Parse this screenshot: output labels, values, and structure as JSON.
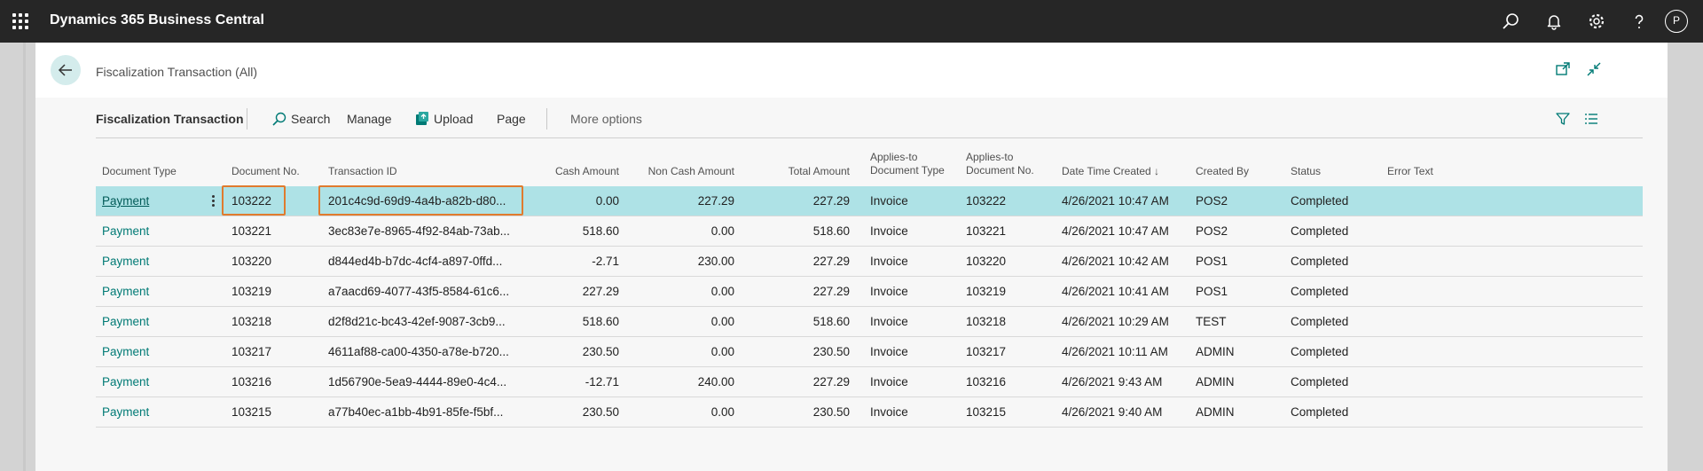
{
  "app": {
    "title": "Dynamics 365 Business Central",
    "avatar": "P"
  },
  "page": {
    "title": "Fiscalization Transaction (All)"
  },
  "actionbar": {
    "title": "Fiscalization Transaction",
    "search": "Search",
    "manage": "Manage",
    "upload": "Upload",
    "page": "Page",
    "more": "More options"
  },
  "columns": {
    "document_type": "Document Type",
    "document_no": "Document No.",
    "transaction_id": "Transaction ID",
    "cash_amount": "Cash Amount",
    "non_cash_amount": "Non Cash Amount",
    "total_amount": "Total Amount",
    "applies_to_doc_type_1": "Applies-to",
    "applies_to_doc_type_2": "Document Type",
    "applies_to_doc_no_1": "Applies-to",
    "applies_to_doc_no_2": "Document No.",
    "date_time_created": "Date Time Created ↓",
    "created_by": "Created By",
    "status": "Status",
    "error_text": "Error Text"
  },
  "rows": [
    {
      "doc_type": "Payment",
      "doc_no": "103222",
      "txn_id": "201c4c9d-69d9-4a4b-a82b-d80...",
      "cash": "0.00",
      "noncash": "227.29",
      "total": "227.29",
      "applies_type": "Invoice",
      "applies_no": "103222",
      "created": "4/26/2021 10:47 AM",
      "by": "POS2",
      "status": "Completed",
      "error": ""
    },
    {
      "doc_type": "Payment",
      "doc_no": "103221",
      "txn_id": "3ec83e7e-8965-4f92-84ab-73ab...",
      "cash": "518.60",
      "noncash": "0.00",
      "total": "518.60",
      "applies_type": "Invoice",
      "applies_no": "103221",
      "created": "4/26/2021 10:47 AM",
      "by": "POS2",
      "status": "Completed",
      "error": ""
    },
    {
      "doc_type": "Payment",
      "doc_no": "103220",
      "txn_id": "d844ed4b-b7dc-4cf4-a897-0ffd...",
      "cash": "-2.71",
      "noncash": "230.00",
      "total": "227.29",
      "applies_type": "Invoice",
      "applies_no": "103220",
      "created": "4/26/2021 10:42 AM",
      "by": "POS1",
      "status": "Completed",
      "error": ""
    },
    {
      "doc_type": "Payment",
      "doc_no": "103219",
      "txn_id": "a7aacd69-4077-43f5-8584-61c6...",
      "cash": "227.29",
      "noncash": "0.00",
      "total": "227.29",
      "applies_type": "Invoice",
      "applies_no": "103219",
      "created": "4/26/2021 10:41 AM",
      "by": "POS1",
      "status": "Completed",
      "error": ""
    },
    {
      "doc_type": "Payment",
      "doc_no": "103218",
      "txn_id": "d2f8d21c-bc43-42ef-9087-3cb9...",
      "cash": "518.60",
      "noncash": "0.00",
      "total": "518.60",
      "applies_type": "Invoice",
      "applies_no": "103218",
      "created": "4/26/2021 10:29 AM",
      "by": "TEST",
      "status": "Completed",
      "error": ""
    },
    {
      "doc_type": "Payment",
      "doc_no": "103217",
      "txn_id": "4611af88-ca00-4350-a78e-b720...",
      "cash": "230.50",
      "noncash": "0.00",
      "total": "230.50",
      "applies_type": "Invoice",
      "applies_no": "103217",
      "created": "4/26/2021 10:11 AM",
      "by": "ADMIN",
      "status": "Completed",
      "error": ""
    },
    {
      "doc_type": "Payment",
      "doc_no": "103216",
      "txn_id": "1d56790e-5ea9-4444-89e0-4c4...",
      "cash": "-12.71",
      "noncash": "240.00",
      "total": "227.29",
      "applies_type": "Invoice",
      "applies_no": "103216",
      "created": "4/26/2021 9:43 AM",
      "by": "ADMIN",
      "status": "Completed",
      "error": ""
    },
    {
      "doc_type": "Payment",
      "doc_no": "103215",
      "txn_id": "a77b40ec-a1bb-4b91-85fe-f5bf...",
      "cash": "230.50",
      "noncash": "0.00",
      "total": "230.50",
      "applies_type": "Invoice",
      "applies_no": "103215",
      "created": "4/26/2021 9:40 AM",
      "by": "ADMIN",
      "status": "Completed",
      "error": ""
    }
  ],
  "selected_row": 0,
  "colors": {
    "accent": "#007a75",
    "selected_row": "#aee2e6",
    "highlight": "#e07b2e",
    "appbar": "#262626"
  }
}
